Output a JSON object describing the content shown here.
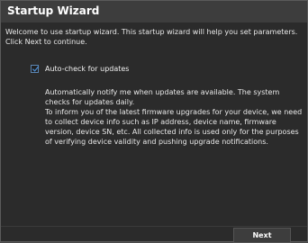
{
  "window": {
    "title": "Startup Wizard"
  },
  "intro_text": "Welcome to use startup wizard. This startup wizard will help you set parameters. Click Next to continue.",
  "auto_check": {
    "checked": true,
    "label": "Auto-check for updates",
    "description_1": "Automatically notify me when updates are available. The system checks for updates daily.",
    "description_2": "To inform you of the latest firmware upgrades for your device, we need to collect device info such as IP address, device name, firmware version, device SN, etc. All collected info is used only for the purposes of verifying device validity and pushing upgrade notifications."
  },
  "footer": {
    "next_label": "Next"
  },
  "colors": {
    "background": "#2b2b2b",
    "titlebar": "#3d3d3d",
    "checkbox_border": "#5c86b3",
    "check_mark": "#4f8fd6",
    "text": "#e8e8e8"
  },
  "icons": {
    "checkbox": "check-icon"
  }
}
